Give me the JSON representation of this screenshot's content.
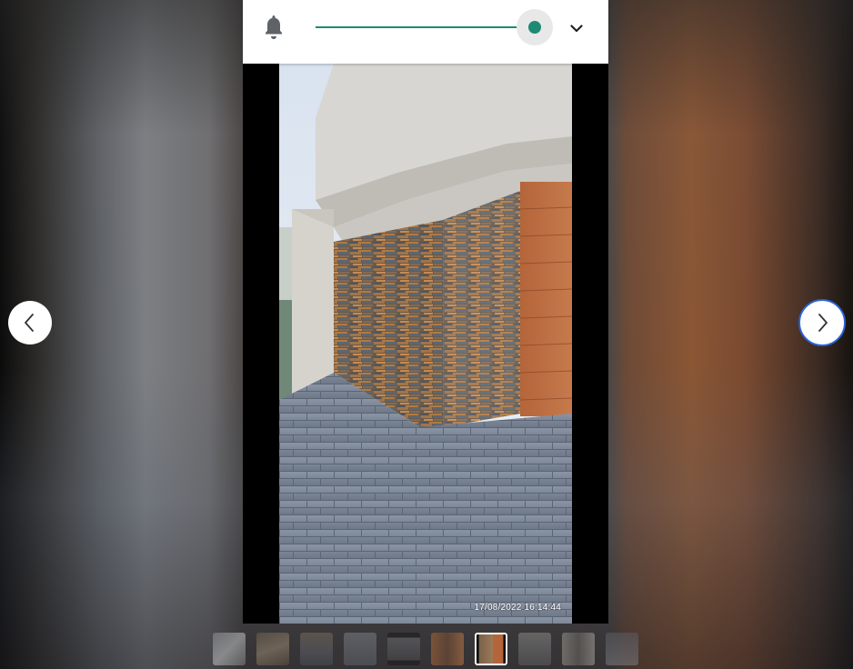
{
  "viewer": {
    "volume_slider": {
      "value": 1.0
    },
    "photo": {
      "timestamp": "17/08/2022 16:14:44",
      "content": "corner of a house with a stacked multicolored slate stone cladding wall, grey concrete overhang, wooden garage door and grey paving"
    },
    "navigation": {
      "prev": "chevron-left-icon",
      "next": "chevron-right-icon"
    },
    "thumbnails": {
      "count": 10,
      "active_index": 6
    },
    "colors": {
      "accent": "#1e8a73",
      "focus_ring": "#2a63d6"
    }
  },
  "icons": {
    "notification": "bell-icon",
    "collapse": "chevron-down-icon"
  }
}
